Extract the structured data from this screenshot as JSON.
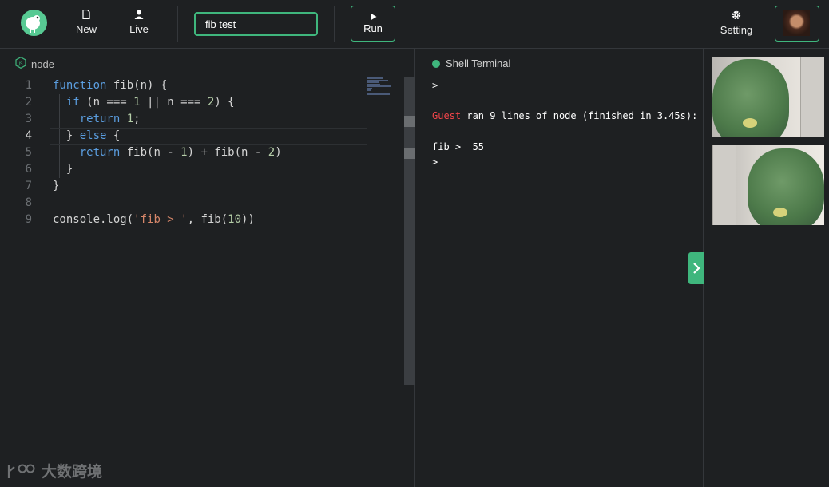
{
  "header": {
    "new_label": "New",
    "live_label": "Live",
    "title_value": "fib test",
    "run_label": "Run",
    "setting_label": "Setting"
  },
  "editor": {
    "language": "node",
    "active_line": 4,
    "line_numbers": [
      "1",
      "2",
      "3",
      "4",
      "5",
      "6",
      "7",
      "8",
      "9"
    ]
  },
  "terminal": {
    "title": "Shell Terminal",
    "prompt1": ">",
    "guest": "Guest",
    "run_message": " ran 9 lines of node (finished in 3.45s):",
    "output": "fib >  55",
    "prompt2": ">"
  },
  "watermark": {
    "text": "大数跨境"
  },
  "colors": {
    "accent": "#3fb67d",
    "guest_red": "#f0454a",
    "keyword": "#5b9ee0",
    "number": "#b5cea8",
    "string": "#d7876a"
  },
  "icons": [
    "dodo-logo-icon",
    "file-icon",
    "user-icon",
    "play-icon",
    "gear-icon",
    "js-icon",
    "chevron-right-icon"
  ]
}
